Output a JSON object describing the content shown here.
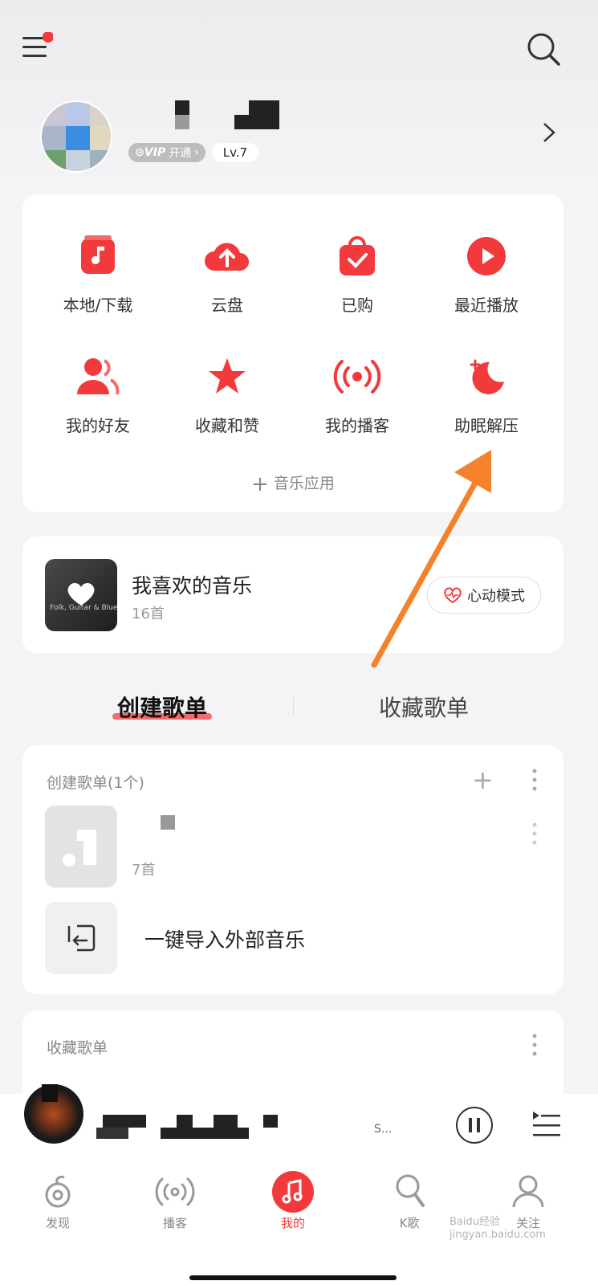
{
  "header": {
    "menu_icon": "hamburger-menu-icon",
    "search_icon": "search-icon"
  },
  "profile": {
    "vip_label": "开通",
    "level": "Lv.7"
  },
  "quick_actions": [
    {
      "label": "本地/下载",
      "icon": "music-note-icon"
    },
    {
      "label": "云盘",
      "icon": "cloud-upload-icon"
    },
    {
      "label": "已购",
      "icon": "bag-check-icon"
    },
    {
      "label": "最近播放",
      "icon": "play-circle-icon"
    },
    {
      "label": "我的好友",
      "icon": "friends-icon"
    },
    {
      "label": "收藏和赞",
      "icon": "star-icon"
    },
    {
      "label": "我的播客",
      "icon": "broadcast-icon"
    },
    {
      "label": "助眠解压",
      "icon": "moon-icon"
    }
  ],
  "music_apps_label": "音乐应用",
  "liked": {
    "title": "我喜欢的音乐",
    "count": "16首",
    "mode_button": "心动模式",
    "cover_text": "Folk, Guitar & Blues"
  },
  "playlist_tabs": {
    "created": "创建歌单",
    "collected": "收藏歌单"
  },
  "created_section": {
    "title": "创建歌单(1个)",
    "playlist_count": "7首",
    "import_label": "一键导入外部音乐"
  },
  "collected_section": {
    "title": "收藏歌单"
  },
  "player": {
    "dots": "S..."
  },
  "bottom_nav": [
    {
      "label": "发现",
      "icon": "discover-icon"
    },
    {
      "label": "播客",
      "icon": "podcast-icon"
    },
    {
      "label": "我的",
      "icon": "music-note-icon"
    },
    {
      "label": "K歌",
      "icon": "microphone-icon"
    },
    {
      "label": "关注",
      "icon": "follow-icon"
    }
  ],
  "watermark": "Baidu经验 jingyan.baidu.com",
  "colors": {
    "accent": "#f23a3c",
    "arrow": "#f5822a"
  }
}
